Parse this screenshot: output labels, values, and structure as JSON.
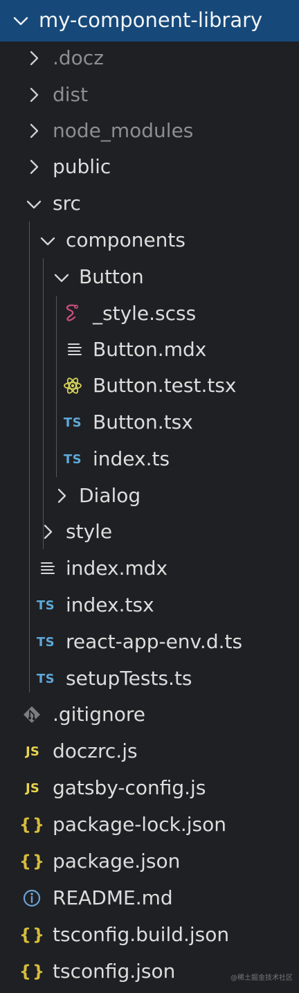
{
  "explorer": {
    "root_label": "my-component-library",
    "items": [
      {
        "label": ".docz",
        "kind": "folder",
        "expanded": false
      },
      {
        "label": "dist",
        "kind": "folder",
        "expanded": false
      },
      {
        "label": "node_modules",
        "kind": "folder",
        "expanded": false
      },
      {
        "label": "public",
        "kind": "folder",
        "expanded": false
      },
      {
        "label": "src",
        "kind": "folder",
        "expanded": true
      },
      {
        "label": "components",
        "kind": "folder",
        "expanded": true
      },
      {
        "label": "Button",
        "kind": "folder",
        "expanded": true
      },
      {
        "label": "_style.scss",
        "kind": "file",
        "icon": "sass-icon"
      },
      {
        "label": "Button.mdx",
        "kind": "file",
        "icon": "lines-icon"
      },
      {
        "label": "Button.test.tsx",
        "kind": "file",
        "icon": "react-icon"
      },
      {
        "label": "Button.tsx",
        "kind": "file",
        "icon": "ts-icon",
        "icon_text": "TS"
      },
      {
        "label": "index.ts",
        "kind": "file",
        "icon": "ts-icon",
        "icon_text": "TS"
      },
      {
        "label": "Dialog",
        "kind": "folder",
        "expanded": false
      },
      {
        "label": "style",
        "kind": "folder",
        "expanded": false
      },
      {
        "label": "index.mdx",
        "kind": "file",
        "icon": "lines-icon"
      },
      {
        "label": "index.tsx",
        "kind": "file",
        "icon": "ts-icon",
        "icon_text": "TS"
      },
      {
        "label": "react-app-env.d.ts",
        "kind": "file",
        "icon": "ts-icon",
        "icon_text": "TS"
      },
      {
        "label": "setupTests.ts",
        "kind": "file",
        "icon": "ts-icon",
        "icon_text": "TS"
      },
      {
        "label": ".gitignore",
        "kind": "file",
        "icon": "git-icon"
      },
      {
        "label": "doczrc.js",
        "kind": "file",
        "icon": "js-icon",
        "icon_text": "JS"
      },
      {
        "label": "gatsby-config.js",
        "kind": "file",
        "icon": "js-icon",
        "icon_text": "JS"
      },
      {
        "label": "package-lock.json",
        "kind": "file",
        "icon": "json-icon",
        "icon_text": "{}"
      },
      {
        "label": "package.json",
        "kind": "file",
        "icon": "json-icon",
        "icon_text": "{}"
      },
      {
        "label": "README.md",
        "kind": "file",
        "icon": "info-icon"
      },
      {
        "label": "tsconfig.build.json",
        "kind": "file",
        "icon": "json-icon",
        "icon_text": "{}"
      },
      {
        "label": "tsconfig.json",
        "kind": "file",
        "icon": "json-icon",
        "icon_text": "{}"
      }
    ]
  },
  "watermark": "@稀土掘金技术社区",
  "colors": {
    "root_bg": "#16497a",
    "panel_bg": "#1f2023",
    "text": "#dddddd",
    "dim_text": "#8d8e91",
    "ts": "#5ea8d8",
    "js": "#e8d44d",
    "json": "#d6bd3d",
    "react": "#d7d45b",
    "sass": "#d04f7f",
    "info": "#6aa2d6",
    "git": "#7b7d80"
  }
}
